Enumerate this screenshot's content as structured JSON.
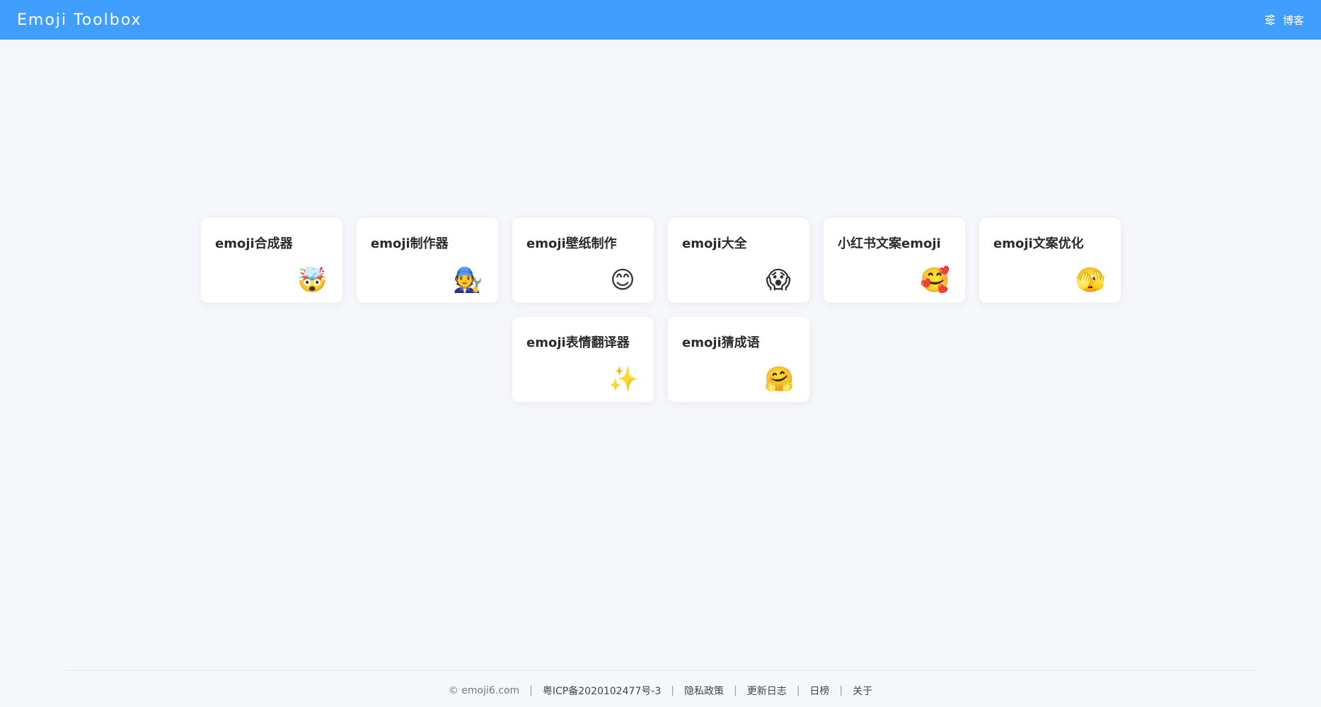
{
  "header": {
    "title": "Emoji Toolbox",
    "blog_label": "博客",
    "blog_icon": "sliders-icon",
    "bg_color": "#409eff"
  },
  "cards": [
    {
      "title": "emoji合成器",
      "emoji": "🤯"
    },
    {
      "title": "emoji制作器",
      "emoji": "🧑‍🔧"
    },
    {
      "title": "emoji壁纸制作",
      "emoji": "😊"
    },
    {
      "title": "emoji大全",
      "emoji": "😱"
    },
    {
      "title": "小红书文案emoji",
      "emoji": "🥰"
    },
    {
      "title": "emoji文案优化",
      "emoji": "🫣"
    },
    {
      "title": "emoji表情翻译器",
      "emoji": "✨"
    },
    {
      "title": "emoji猜成语",
      "emoji": "🤗"
    }
  ],
  "footer": {
    "copyright": "© emoji6.com",
    "icp": "粤ICP备2020102477号-3",
    "privacy": "隐私政策",
    "changelog": "更新日志",
    "daily": "日榜",
    "about": "关于",
    "separator": "|"
  }
}
